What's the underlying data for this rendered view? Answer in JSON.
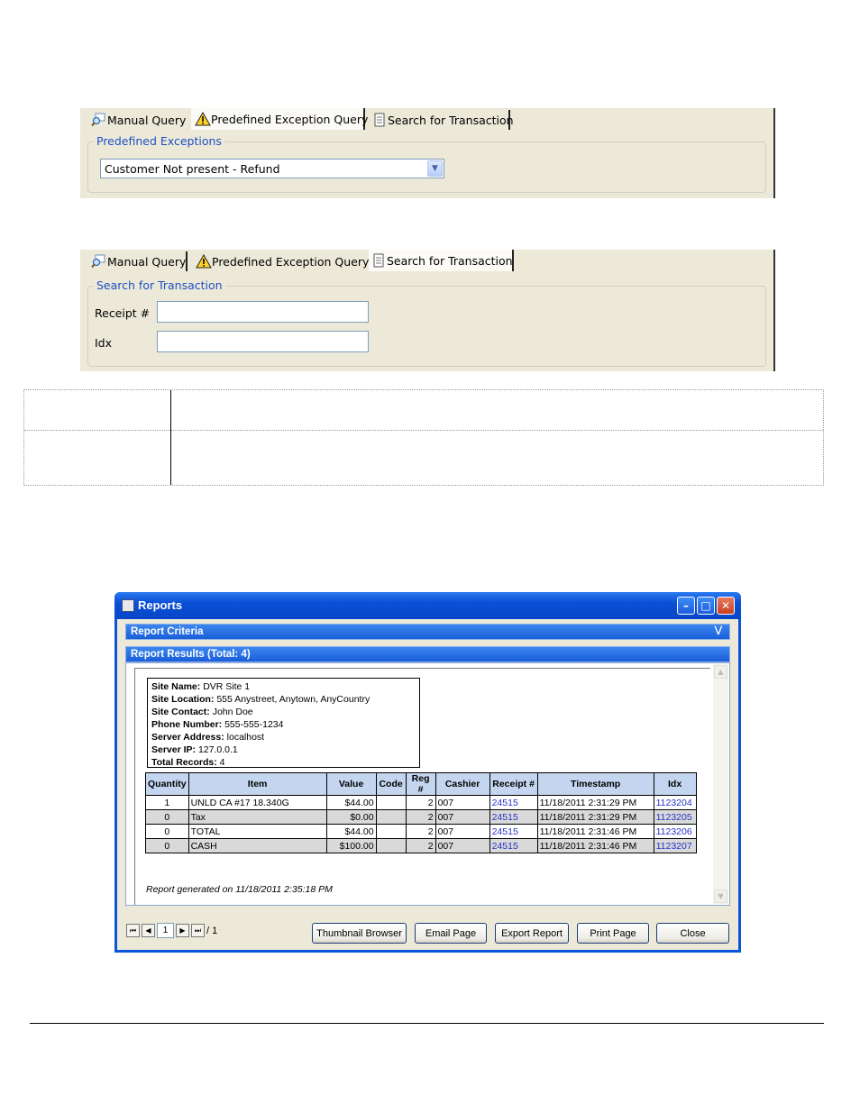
{
  "tabs": [
    {
      "label": "Manual Query",
      "icon": "magnifier-query-icon"
    },
    {
      "label": "Predefined Exception Query",
      "icon": "warning-icon"
    },
    {
      "label": "Search for Transaction",
      "icon": "document-icon"
    }
  ],
  "panel1": {
    "group_title": "Predefined Exceptions",
    "selected_exception": "Customer Not present - Refund"
  },
  "panel2": {
    "group_title": "Search for Transaction",
    "receipt_label": "Receipt #",
    "receipt_value": "",
    "idx_label": "Idx",
    "idx_value": ""
  },
  "reports_window": {
    "title": "Reports",
    "criteria_title": "Report Criteria",
    "results_title": "Report Results (Total: 4)",
    "site_info": [
      {
        "label": "Site Name:",
        "value": "DVR Site 1"
      },
      {
        "label": "Site Location:",
        "value": "555 Anystreet, Anytown, AnyCountry"
      },
      {
        "label": "Site Contact:",
        "value": "John Doe"
      },
      {
        "label": "Phone Number:",
        "value": "555-555-1234"
      },
      {
        "label": "Server Address:",
        "value": "localhost"
      },
      {
        "label": "Server IP:",
        "value": "127.0.0.1"
      },
      {
        "label": "Total Records:",
        "value": "4"
      }
    ],
    "columns": [
      "Quantity",
      "Item",
      "Value",
      "Code",
      "Reg #",
      "Cashier",
      "Receipt #",
      "Timestamp",
      "Idx"
    ],
    "rows": [
      {
        "quantity": "1",
        "item": "UNLD CA #17      18.340G",
        "value": "$44.00",
        "code": "",
        "reg": "2",
        "cashier": "007",
        "receipt": "24515",
        "timestamp": "11/18/2011 2:31:29 PM",
        "idx": "1123204"
      },
      {
        "quantity": "0",
        "item": "Tax",
        "value": "$0.00",
        "code": "",
        "reg": "2",
        "cashier": "007",
        "receipt": "24515",
        "timestamp": "11/18/2011 2:31:29 PM",
        "idx": "1123205"
      },
      {
        "quantity": "0",
        "item": "TOTAL",
        "value": "$44.00",
        "code": "",
        "reg": "2",
        "cashier": "007",
        "receipt": "24515",
        "timestamp": "11/18/2011 2:31:46 PM",
        "idx": "1123206"
      },
      {
        "quantity": "0",
        "item": "CASH",
        "value": "$100.00",
        "code": "",
        "reg": "2",
        "cashier": "007",
        "receipt": "24515",
        "timestamp": "11/18/2011 2:31:46 PM",
        "idx": "1123207"
      }
    ],
    "generated_note": "Report generated on 11/18/2011 2:35:18 PM",
    "pager": {
      "current_page": "1",
      "total_pages": "/ 1"
    },
    "buttons": {
      "thumbnail": "Thumbnail Browser",
      "email": "Email Page",
      "export": "Export Report",
      "print": "Print Page",
      "close": "Close"
    }
  }
}
